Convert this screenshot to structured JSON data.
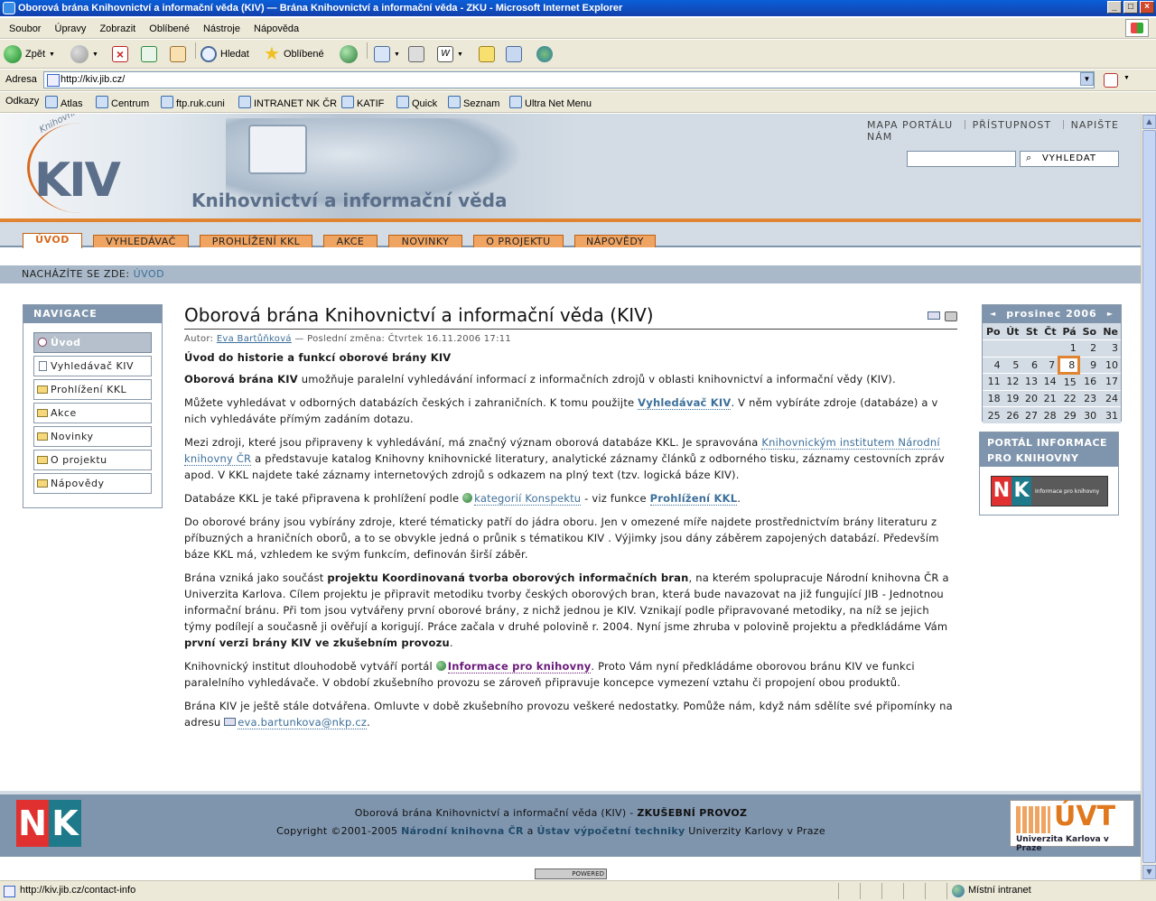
{
  "window": {
    "title": "Oborová brána Knihovnictví a informační věda (KIV) — Brána Knihovnictví a informační věda - ZKU - Microsoft Internet Explorer"
  },
  "menu": [
    "Soubor",
    "Úpravy",
    "Zobrazit",
    "Oblíbené",
    "Nástroje",
    "Nápověda"
  ],
  "toolbar": {
    "back": "Zpět",
    "search": "Hledat",
    "favorites": "Oblíbené"
  },
  "address": {
    "label": "Adresa",
    "url": "http://kiv.jib.cz/"
  },
  "links": {
    "label": "Odkazy",
    "items": [
      "Atlas",
      "Centrum",
      "ftp.ruk.cuni",
      "INTRANET NK ČR",
      "KATIF",
      "Quick",
      "Seznam",
      "Ultra Net Menu"
    ]
  },
  "site": {
    "logo_text": "KIV",
    "logo_tag": "Knihovnictví a informační věda",
    "title": "Knihovnictví a informační věda",
    "portal_links": [
      "MAPA PORTÁLU",
      "PŘÍSTUPNOST",
      "NAPIŠTE NÁM"
    ],
    "search_button": "VYHLEDAT",
    "tabs": [
      "ÚVOD",
      "VYHLEDÁVAČ",
      "PROHLÍŽENÍ KKL",
      "AKCE",
      "NOVINKY",
      "O PROJEKTU",
      "NÁPOVĚDY"
    ],
    "breadcrumb_label": "NACHÁZÍTE SE ZDE:",
    "breadcrumb_item": "ÚVOD"
  },
  "nav": {
    "heading": "NAVIGACE",
    "items": [
      "Úvod",
      "Vyhledávač KIV",
      "Prohlížení KKL",
      "Akce",
      "Novinky",
      "O projektu",
      "Nápovědy"
    ]
  },
  "article": {
    "title": "Oborová brána Knihovnictví a informační věda (KIV)",
    "byline_prefix": "Autor:",
    "author": "Eva Bartůňková",
    "byline_suffix": "— Poslední změna: Čtvrtek 16.11.2006 17:11",
    "subtitle": "Úvod do historie a funkcí oborové brány KIV",
    "p1_b": "Oborová  brána KIV",
    "p1": " umožňuje paralelní vyhledávání informací z informačních zdrojů v oblasti knihovnictví a informační vědy (KIV).",
    "p2a": "Můžete vyhledávat v odborných databázích českých i zahraničních. K tomu použijte ",
    "p2_link": "Vyhledávač KIV",
    "p2b": ". V něm vybíráte zdroje (databáze) a v nich vyhledáváte přímým zadáním dotazu.",
    "p3a": "Mezi zdroji, které jsou připraveny k vyhledávání, má značný význam oborová databáze KKL. Je spravována ",
    "p3_link": "Knihovnickým institutem Národní knihovny ČR",
    "p3b": " a představuje katalog Knihovny knihovnické literatury, analytické záznamy článků z odborného tisku, záznamy cestovních zpráv apod. V KKL najdete také záznamy internetových zdrojů s odkazem na plný text (tzv. logická báze KIV).",
    "p4a": "Databáze KKL je také připravena k prohlížení podle ",
    "p4_link": "kategorií Konspektu",
    "p4b": " - viz funkce ",
    "p4_link2": "Prohlížení KKL",
    "p4c": ".",
    "p5": "Do oborové brány jsou vybírány zdroje, které tématicky patří do jádra oboru. Jen v omezené míře najdete prostřednictvím brány literaturu z příbuzných a hraničních oborů, a to se obvykle jedná o průnik s tématikou KIV . Výjimky jsou dány záběrem zapojených databází. Především báze KKL má, vzhledem ke svým funkcím, definován širší záběr.",
    "p6a": "Brána vzniká jako součást ",
    "p6_b": "projektu Koordinovaná tvorba oborových informačních bran",
    "p6b": ", na kterém spolupracuje Národní knihovna ČR a Univerzita Karlova. Cílem projektu je připravit metodiku  tvorby českých oborových bran, která bude navazovat na již fungující JIB - Jednotnou informační bránu. Při tom jsou vytvářeny první oborové brány, z nichž jednou je KIV. Vznikají podle připravované metodiky, na níž se jejich týmy podílejí a současně ji ověřují a korigují. Práce začala v druhé polovině r. 2004. Nyní jsme zhruba v polovině projektu a předkládáme Vám ",
    "p6_b2": "první verzi brány KIV ve zkušebním provozu",
    "p6c": ".",
    "p7a": "Knihovnický institut dlouhodobě vytváří portál ",
    "p7_link": "Informace pro knihovny",
    "p7b": ". Proto Vám nyní předkládáme oborovou bránu KIV ve funkci paralelního vyhledávače. V období zkušebního provozu se zároveň připravuje koncepce  vymezení vztahu či propojení obou produktů.",
    "p8a": "Brána KIV je ještě stále dotvářena. Omluvte v době zkušebního provozu veškeré nedostatky. Pomůže nám, když nám sdělíte své připomínky na adresu ",
    "p8_link": "eva.bartunkova@nkp.cz",
    "p8b": "."
  },
  "calendar": {
    "month": "prosinec 2006",
    "prev": "◄",
    "next": "►",
    "days": [
      "Po",
      "Út",
      "St",
      "Čt",
      "Pá",
      "So",
      "Ne"
    ],
    "weeks": [
      [
        "",
        "",
        "",
        "",
        "1",
        "2",
        "3"
      ],
      [
        "4",
        "5",
        "6",
        "7",
        "8",
        "9",
        "10"
      ],
      [
        "11",
        "12",
        "13",
        "14",
        "15",
        "16",
        "17"
      ],
      [
        "18",
        "19",
        "20",
        "21",
        "22",
        "23",
        "24"
      ],
      [
        "25",
        "26",
        "27",
        "28",
        "29",
        "30",
        "31"
      ]
    ],
    "today": "8"
  },
  "portal_box": {
    "heading": "PORTÁL INFORMACE PRO KNIHOVNY",
    "logo_caption": "Informace pro knihovny"
  },
  "footer": {
    "line1a": "Oborová brána Knihovnictví a informační věda (KIV) - ",
    "line1b": "ZKUŠEBNÍ PROVOZ",
    "line2a": "Copyright ©2001-2005 ",
    "line2_link1": "Národní knihovna ČR",
    "line2b": " a ",
    "line2_link2": "Ústav výpočetní techniky",
    "line2c": " Univerzity Karlovy v Praze",
    "uvt_big": "ÚVT",
    "uvt_small": "Univerzita Karlova v Praze",
    "powered": "POWERED"
  },
  "status": {
    "text": "http://kiv.jib.cz/contact-info",
    "zone": "Místní intranet"
  }
}
